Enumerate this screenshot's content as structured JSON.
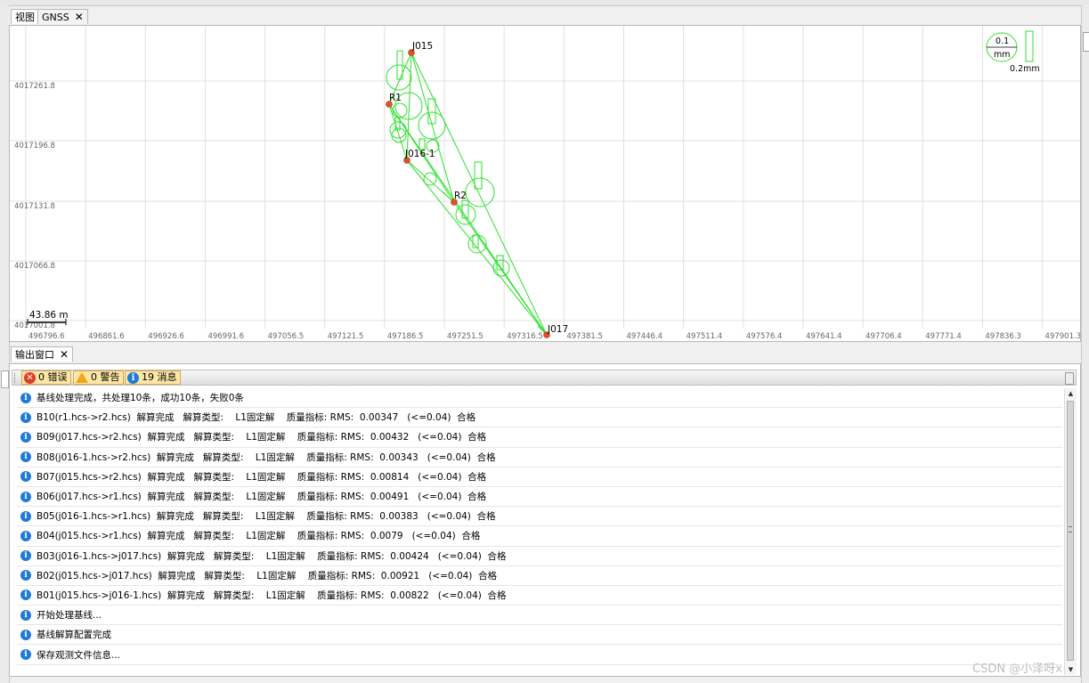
{
  "tabs": [
    {
      "label": "视图",
      "active": true
    },
    {
      "label": "GNSS",
      "active": false
    }
  ],
  "view": {
    "x_axis_labels": [
      "496796.6",
      "496861.6",
      "496926.6",
      "496991.6",
      "497056.5",
      "497121.5",
      "497186.5",
      "497251.5",
      "497316.5",
      "497381.5",
      "497446.4",
      "497511.4",
      "497576.4",
      "497641.4",
      "497706.4",
      "497771.4",
      "497836.3",
      "497901.3"
    ],
    "y_axis_labels": [
      "4017261.8",
      "4017196.8",
      "4017131.8",
      "4017066.8",
      "4017001.8"
    ],
    "scale_bar": "43.86 m",
    "legend": {
      "ellipse_label": "0.1",
      "ellipse_unit": "mm",
      "bar_label": "0.2mm"
    },
    "points": [
      {
        "name": "J015"
      },
      {
        "name": "R1"
      },
      {
        "name": "J016-1"
      },
      {
        "name": "R2"
      },
      {
        "name": "J017"
      }
    ],
    "colors": {
      "network": "#2fe02f",
      "point": "#e0521f",
      "grid": "#e0e0e0"
    }
  },
  "output": {
    "tab_label": "输出窗口",
    "errors_btn": "0 错误",
    "warnings_btn": "0 警告",
    "messages_btn": "19 消息",
    "messages": [
      "基线处理完成，共处理10条，成功10条，失败0条",
      "B10(r1.hcs->r2.hcs)  解算完成   解算类型:    L1固定解    质量指标: RMS:  0.00347   (<=0.04)  合格",
      "B09(j017.hcs->r2.hcs)  解算完成   解算类型:    L1固定解    质量指标: RMS:  0.00432   (<=0.04)  合格",
      "B08(j016-1.hcs->r2.hcs)  解算完成   解算类型:    L1固定解    质量指标: RMS:  0.00343   (<=0.04)  合格",
      "B07(j015.hcs->r2.hcs)  解算完成   解算类型:    L1固定解    质量指标: RMS:  0.00814   (<=0.04)  合格",
      "B06(j017.hcs->r1.hcs)  解算完成   解算类型:    L1固定解    质量指标: RMS:  0.00491   (<=0.04)  合格",
      "B05(j016-1.hcs->r1.hcs)  解算完成   解算类型:    L1固定解    质量指标: RMS:  0.00383   (<=0.04)  合格",
      "B04(j015.hcs->r1.hcs)  解算完成   解算类型:    L1固定解    质量指标: RMS:  0.0079   (<=0.04)  合格",
      "B03(j016-1.hcs->j017.hcs)  解算完成   解算类型:    L1固定解    质量指标: RMS:  0.00424   (<=0.04)  合格",
      "B02(j015.hcs->j017.hcs)  解算完成   解算类型:    L1固定解    质量指标: RMS:  0.00921   (<=0.04)  合格",
      "B01(j015.hcs->j016-1.hcs)  解算完成   解算类型:    L1固定解    质量指标: RMS:  0.00822   (<=0.04)  合格",
      "开始处理基线...",
      "基线解算配置完成",
      "保存观测文件信息..."
    ]
  },
  "watermark": "CSDN @小泽呀x"
}
